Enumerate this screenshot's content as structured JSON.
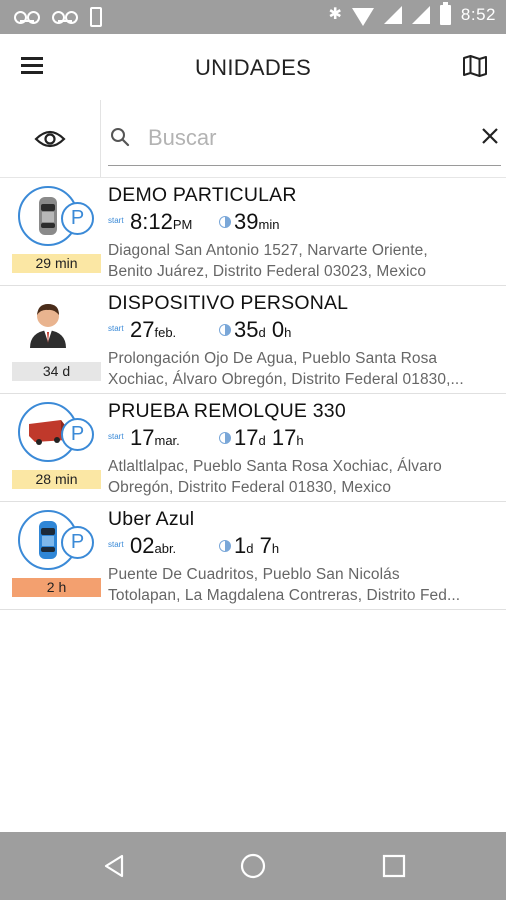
{
  "status_bar": {
    "time": "8:52",
    "icons": [
      "voicemail-icon",
      "voicemail-icon",
      "phone-icon",
      "bluetooth-icon",
      "wifi-icon",
      "signal-icon",
      "battery-icon"
    ]
  },
  "header": {
    "title": "UNIDADES",
    "menu_icon": "hamburger-icon",
    "map_icon": "map-icon"
  },
  "search": {
    "placeholder": "Buscar",
    "value": "",
    "visibility_icon": "eye-icon",
    "search_icon": "magnifier-icon",
    "clear_icon": "close-icon"
  },
  "colors": {
    "accent": "#3b8ad7",
    "badge_yellow": "#fbe7a4",
    "badge_gray": "#e6e6e6",
    "badge_orange": "#f3a06f",
    "bars": "#9e9e9e"
  },
  "units": [
    {
      "name": "DEMO PARTICULAR",
      "icon": "car-gray-icon",
      "parked": true,
      "badge": "29 min",
      "badge_color": "#fbe7a4",
      "start_label": "start",
      "start_main": "8:12",
      "start_suffix": "PM",
      "duration": [
        {
          "num": "39",
          "unit": "min"
        }
      ],
      "address": [
        "Diagonal San Antonio 1527, Narvarte Oriente,",
        "Benito Juárez, Distrito Federal 03023, Mexico"
      ]
    },
    {
      "name": "DISPOSITIVO PERSONAL",
      "icon": "person-icon",
      "parked": false,
      "badge": "34 d",
      "badge_color": "#e6e6e6",
      "start_label": "start",
      "start_main": "27",
      "start_suffix": "feb.",
      "duration": [
        {
          "num": "35",
          "unit": "d"
        },
        {
          "num": "0",
          "unit": "h"
        }
      ],
      "address": [
        "Prolongación Ojo De Agua, Pueblo Santa Rosa",
        "Xochiac, Álvaro Obregón, Distrito Federal 01830,..."
      ]
    },
    {
      "name": "PRUEBA REMOLQUE 330",
      "icon": "trailer-red-icon",
      "parked": true,
      "badge": "28 min",
      "badge_color": "#fbe7a4",
      "start_label": "start",
      "start_main": "17",
      "start_suffix": "mar.",
      "duration": [
        {
          "num": "17",
          "unit": "d"
        },
        {
          "num": "17",
          "unit": "h"
        }
      ],
      "address": [
        "Atlaltlalpac, Pueblo Santa Rosa Xochiac, Álvaro",
        "Obregón, Distrito Federal 01830, Mexico"
      ]
    },
    {
      "name": "Uber Azul",
      "icon": "car-blue-icon",
      "parked": true,
      "badge": "2 h",
      "badge_color": "#f3a06f",
      "start_label": "start",
      "start_main": "02",
      "start_suffix": "abr.",
      "duration": [
        {
          "num": "1",
          "unit": "d"
        },
        {
          "num": "7",
          "unit": "h"
        }
      ],
      "address": [
        "Puente De Cuadritos, Pueblo San Nicolás",
        "Totolapan, La Magdalena Contreras, Distrito Fed..."
      ]
    }
  ],
  "nav_bar": {
    "back_icon": "back-triangle-icon",
    "home_icon": "home-circle-icon",
    "recents_icon": "recents-square-icon"
  }
}
